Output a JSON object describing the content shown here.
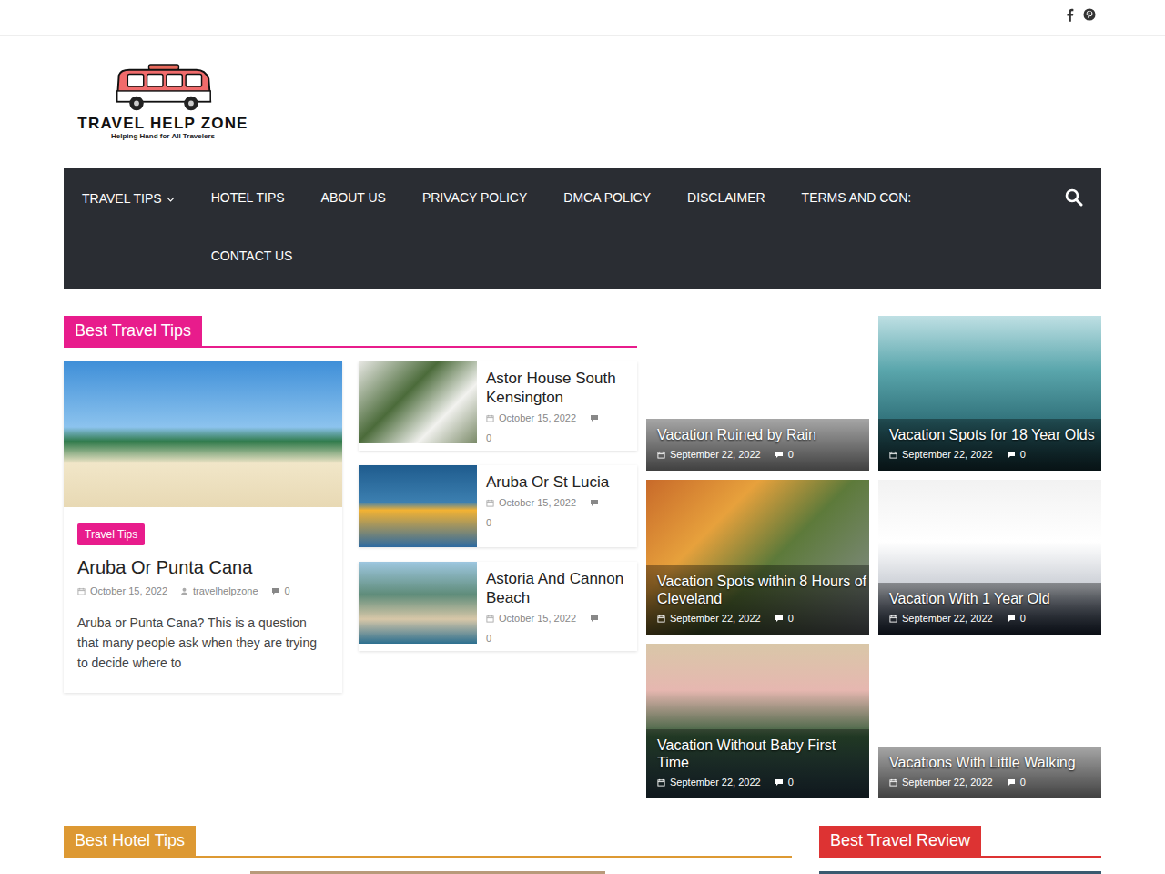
{
  "logo": {
    "title": "TRAVEL HELP ZONE",
    "tagline": "Helping Hand for All Travelers"
  },
  "nav": {
    "items": [
      {
        "label": "TRAVEL TIPS",
        "dropdown": true
      },
      {
        "label": "HOTEL TIPS",
        "dropdown": false
      },
      {
        "label": "ABOUT US",
        "dropdown": false
      },
      {
        "label": "PRIVACY POLICY",
        "dropdown": false
      },
      {
        "label": "DMCA POLICY",
        "dropdown": false
      },
      {
        "label": "DISCLAIMER",
        "dropdown": false
      },
      {
        "label": "TERMS AND CON:",
        "dropdown": false
      },
      {
        "label": "CONTACT US",
        "dropdown": false
      }
    ]
  },
  "travel_tips": {
    "heading": "Best Travel Tips",
    "featured": {
      "tag": "Travel Tips",
      "title": "Aruba Or Punta Cana",
      "date": "October 15, 2022",
      "author": "travelhelpzone",
      "comments": "0",
      "excerpt": "Aruba or Punta Cana? This is a question that many people ask when they are trying to decide where to"
    },
    "list": [
      {
        "title": "Astor House South Kensington",
        "date": "October 15, 2022",
        "comments": "0"
      },
      {
        "title": "Aruba Or St Lucia",
        "date": "October 15, 2022",
        "comments": "0"
      },
      {
        "title": "Astoria And Cannon Beach",
        "date": "October 15, 2022",
        "comments": "0"
      }
    ]
  },
  "tiles": [
    {
      "title": "Vacation Ruined by Rain",
      "date": "September 22, 2022",
      "comments": "0",
      "image": false
    },
    {
      "title": "Vacation Spots for 18 Year Olds",
      "date": "September 22, 2022",
      "comments": "0",
      "image": true
    },
    {
      "title": "Vacation Spots within 8 Hours of Cleveland",
      "date": "September 22, 2022",
      "comments": "0",
      "image": true
    },
    {
      "title": "Vacation With 1 Year Old",
      "date": "September 22, 2022",
      "comments": "0",
      "image": true
    },
    {
      "title": "Vacation Without Baby First Time",
      "date": "September 22, 2022",
      "comments": "0",
      "image": true
    },
    {
      "title": "Vacations With Little Walking",
      "date": "September 22, 2022",
      "comments": "0",
      "image": false
    }
  ],
  "hotel_tips": {
    "heading": "Best Hotel Tips"
  },
  "travel_review": {
    "heading": "Best Travel Review"
  }
}
